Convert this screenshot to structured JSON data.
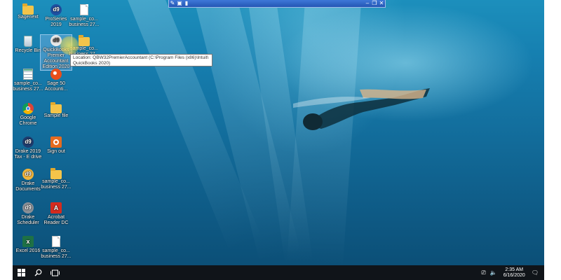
{
  "window": {
    "type": "remote-desktop"
  },
  "rdp_bar": {
    "icons": [
      "pin-icon",
      "lock-icon",
      "signal-icon",
      "minimize-icon",
      "restore-icon",
      "close-icon"
    ]
  },
  "desktop": {
    "icons": [
      {
        "label": "Sagenext",
        "icon": "folder-icon"
      },
      {
        "label": "ProSeries 2019",
        "icon": "proseries-icon"
      },
      {
        "label": "sample_co... business 27...",
        "icon": "document-icon"
      },
      {
        "label": "Recycle Bin",
        "icon": "recycle-bin-icon"
      },
      {
        "label": "QuickBooks Premier Accountant Edition 2020",
        "icon": "quickbooks-icon"
      },
      {
        "label": "sample_co... business 27...",
        "icon": "folder-icon"
      },
      {
        "label": "sample_co... business 27...",
        "icon": "spreadsheet-icon"
      },
      {
        "label": "Sage 50 Accounti...",
        "icon": "sage-icon"
      },
      {
        "label": "Google Chrome",
        "icon": "chrome-icon"
      },
      {
        "label": "Sample file",
        "icon": "folder-icon"
      },
      {
        "label": "Drake 2019 Tax - E drive",
        "icon": "drake-icon"
      },
      {
        "label": "Sign out",
        "icon": "sign-out-icon"
      },
      {
        "label": "Drake Documents",
        "icon": "drake-icon"
      },
      {
        "label": "sample_co... business 27...",
        "icon": "folder-icon"
      },
      {
        "label": "Drake Scheduler",
        "icon": "drake-icon"
      },
      {
        "label": "Acrobat Reader DC",
        "icon": "acrobat-icon"
      },
      {
        "label": "Excel 2016",
        "icon": "excel-icon"
      },
      {
        "label": "sample_co... business 27...",
        "icon": "document-icon"
      }
    ],
    "tooltip": {
      "line1": "Location: QBW32PremierAccountant (C:\\Program Files (x86)\\Intuit\\",
      "line2": "QuickBooks 2020)"
    }
  },
  "taskbar": {
    "start_icon": "windows-logo-icon",
    "search_icon": "search-icon",
    "task_view_icon": "task-view-icon",
    "tray_icons": [
      "network-icon",
      "volume-icon"
    ],
    "time": "2:35 AM",
    "date": "6/16/2020",
    "notification_icon": "notification-icon"
  },
  "colors": {
    "taskbar": "#101419",
    "rdp_bar": "#2e63c4",
    "highlight": "#ffe050"
  }
}
